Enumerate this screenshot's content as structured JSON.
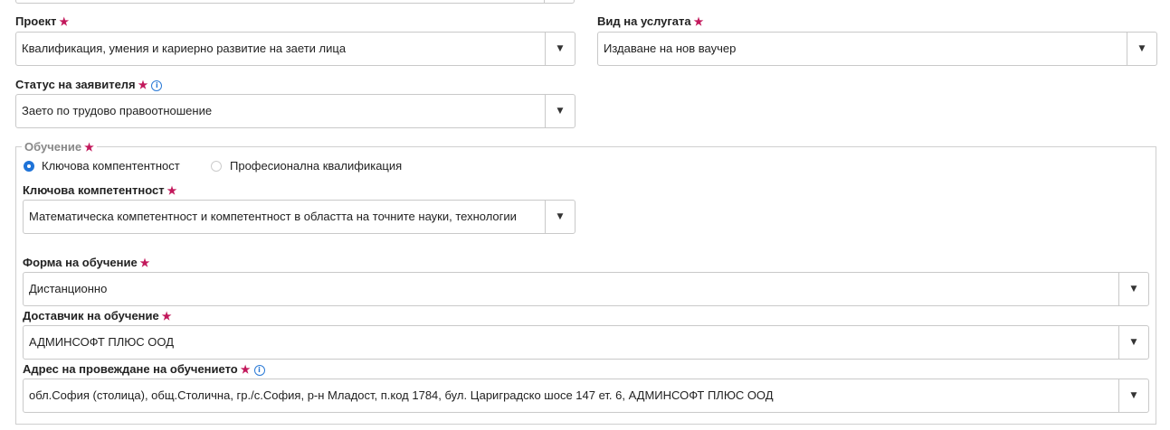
{
  "fields": {
    "project": {
      "label": "Проект",
      "value": "Квалификация, умения и кариерно развитие на заети лица"
    },
    "service_type": {
      "label": "Вид на услугата",
      "value": "Издаване на нов ваучер"
    },
    "applicant_status": {
      "label": "Статус на заявителя",
      "value": "Заето по трудово правоотношение"
    },
    "training": {
      "legend": "Обучение",
      "radio_options": [
        {
          "label": "Ключова компентентност",
          "selected": true
        },
        {
          "label": "Професионална квалификация",
          "selected": false
        }
      ],
      "key_competence": {
        "label": "Ключова компетентност",
        "value": "Математическа компетентност и компетентност в областта на точните науки, технологии"
      },
      "training_form": {
        "label": "Форма на обучение",
        "value": "Дистанционно"
      },
      "provider": {
        "label": "Доставчик на обучение",
        "value": "АДМИНСОФТ ПЛЮС ООД"
      },
      "address": {
        "label": "Адрес на провеждане на обучението",
        "value": "обл.София (столица), общ.Столична, гр./с.София, р-н Младост, п.код 1784, бул. Цариградско шосе 147 ет. 6, АДМИНСОФТ ПЛЮС ООД"
      }
    }
  },
  "symbols": {
    "required": "★",
    "info": "i",
    "dropdown": "▼"
  },
  "colors": {
    "required_star": "#c2185b",
    "radio_selected": "#1e73d8",
    "info_icon": "#2b7ad6"
  }
}
